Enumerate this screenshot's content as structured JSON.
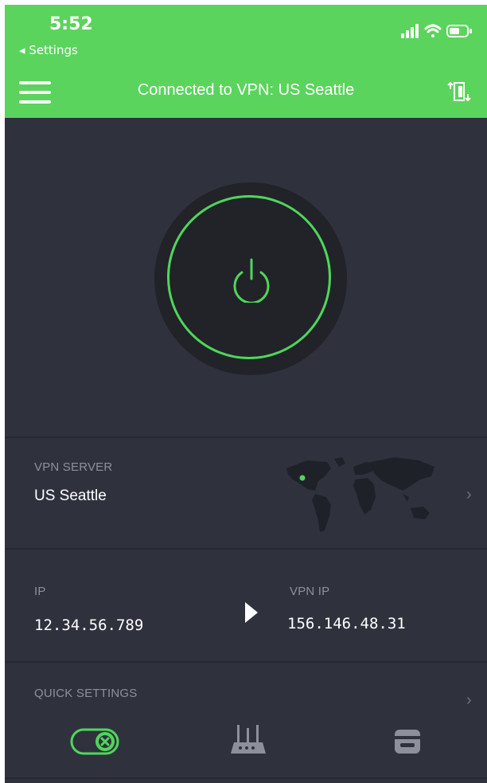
{
  "status_bar": {
    "time": "5:52",
    "back_label": "◂ Settings"
  },
  "header": {
    "title": "Connected to VPN: US Seattle"
  },
  "server": {
    "label": "VPN SERVER",
    "name": "US Seattle"
  },
  "ip": {
    "label": "IP",
    "value": "12.34.56.789"
  },
  "vpn_ip": {
    "label": "VPN IP",
    "value": "156.146.48.31"
  },
  "quick_settings": {
    "label": "QUICK SETTINGS"
  },
  "colors": {
    "accent_green": "#5ad45c",
    "background": "#2f323d",
    "ring_green": "#4fd65a"
  },
  "icons": {
    "menu": "hamburger-icon",
    "split": "split-tunnel-icon",
    "power": "power-icon",
    "arrow": "play-arrow-icon",
    "map": "world-map",
    "qs1": "kill-switch-toggle-icon",
    "qs2": "router-icon",
    "qs3": "adblock-icon"
  }
}
